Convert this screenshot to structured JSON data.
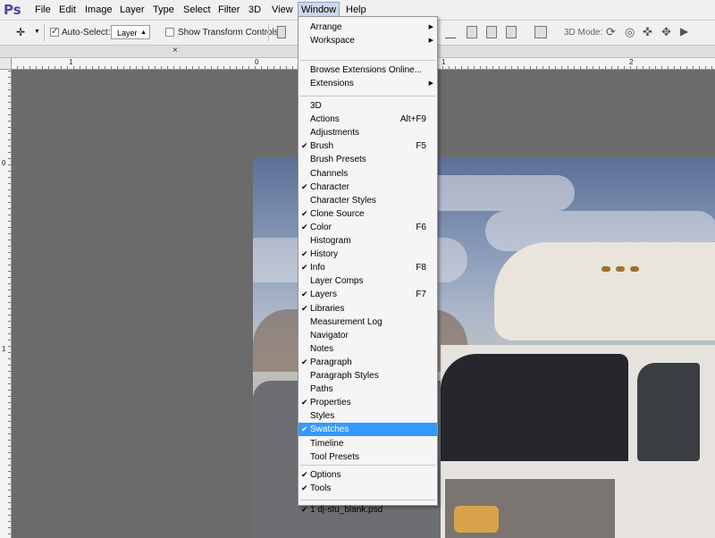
{
  "app": {
    "logo": "Ps"
  },
  "menubar": {
    "items": [
      "File",
      "Edit",
      "Image",
      "Layer",
      "Type",
      "Select",
      "Filter",
      "3D",
      "View",
      "Window",
      "Help"
    ],
    "active": "Window"
  },
  "options": {
    "auto_select_label": "Auto-Select:",
    "auto_select_checked": "✓",
    "target_value": "Layer",
    "transform_label": "Show Transform Controls",
    "mode_label": "3D Mode:"
  },
  "tabstrip": {
    "close_glyph": "×"
  },
  "rulers": {
    "top_numbers": [
      "1",
      "0",
      "1",
      "2"
    ],
    "left_numbers": [
      "0",
      "1"
    ]
  },
  "window_menu": {
    "groups": [
      [
        {
          "label": "Arrange",
          "submenu": true
        },
        {
          "label": "Workspace",
          "submenu": true
        }
      ],
      [
        {
          "label": "Browse Extensions Online..."
        },
        {
          "label": "Extensions",
          "submenu": true
        }
      ],
      [
        {
          "label": "3D"
        },
        {
          "label": "Actions",
          "shortcut": "Alt+F9"
        },
        {
          "label": "Adjustments"
        },
        {
          "label": "Brush",
          "shortcut": "F5",
          "checked": true
        },
        {
          "label": "Brush Presets"
        },
        {
          "label": "Channels"
        },
        {
          "label": "Character",
          "checked": true
        },
        {
          "label": "Character Styles"
        },
        {
          "label": "Clone Source",
          "checked": true
        },
        {
          "label": "Color",
          "shortcut": "F6",
          "checked": true
        },
        {
          "label": "Histogram"
        },
        {
          "label": "History",
          "checked": true
        },
        {
          "label": "Info",
          "shortcut": "F8",
          "checked": true
        },
        {
          "label": "Layer Comps"
        },
        {
          "label": "Layers",
          "shortcut": "F7",
          "checked": true
        },
        {
          "label": "Libraries",
          "checked": true
        },
        {
          "label": "Measurement Log"
        },
        {
          "label": "Navigator"
        },
        {
          "label": "Notes"
        },
        {
          "label": "Paragraph",
          "checked": true
        },
        {
          "label": "Paragraph Styles"
        },
        {
          "label": "Paths"
        },
        {
          "label": "Properties",
          "checked": true
        },
        {
          "label": "Styles"
        },
        {
          "label": "Swatches",
          "checked": true,
          "highlighted": true
        },
        {
          "label": "Timeline"
        },
        {
          "label": "Tool Presets"
        }
      ],
      [
        {
          "label": "Options",
          "checked": true
        },
        {
          "label": "Tools",
          "checked": true
        }
      ],
      [
        {
          "label": "1 dj-stu_blank.psd",
          "checked": true
        }
      ]
    ],
    "check_glyph": "✔",
    "submenu_glyph": "▶"
  }
}
